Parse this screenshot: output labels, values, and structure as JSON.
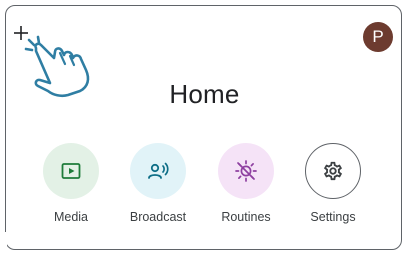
{
  "colors": {
    "avatar_bg": "#6d3b2f",
    "media_bg": "#e3f1e6",
    "media_fg": "#1e7c3a",
    "broadcast_bg": "#e1f3f8",
    "broadcast_fg": "#0e6e87",
    "routines_bg": "#f5e3f7",
    "routines_fg": "#8e3fa0",
    "settings_border": "#5f6368",
    "settings_fg": "#3c4043",
    "hand_stroke": "#2f7ea3"
  },
  "header": {
    "add_icon": "plus-icon",
    "tap_gesture_icon": "hand-tap-icon",
    "avatar_letter": "P"
  },
  "main": {
    "title": "Home",
    "actions": [
      {
        "label": "Media",
        "icon": "play-icon"
      },
      {
        "label": "Broadcast",
        "icon": "broadcast-icon"
      },
      {
        "label": "Routines",
        "icon": "routines-sun-icon"
      },
      {
        "label": "Settings",
        "icon": "gear-icon"
      }
    ]
  }
}
